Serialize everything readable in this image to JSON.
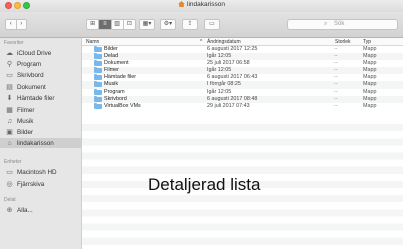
{
  "window": {
    "title": "lindakarisson"
  },
  "toolbar": {
    "back": "‹",
    "forward": "›",
    "view_icons": [
      "⊞",
      "≡",
      "▥",
      "⊡"
    ],
    "arrange": "▦▾",
    "action": "⚙▾",
    "share": "⇪",
    "tag": "▭",
    "search_placeholder": "Sök",
    "search_icon": "⌕"
  },
  "sidebar": {
    "favorites_heading": "Favoriter",
    "favorites": [
      {
        "label": "iCloud Drive",
        "icon": "☁"
      },
      {
        "label": "Program",
        "icon": "⚲"
      },
      {
        "label": "Skrivbord",
        "icon": "▭"
      },
      {
        "label": "Dokument",
        "icon": "▤"
      },
      {
        "label": "Hämtade filer",
        "icon": "⬇"
      },
      {
        "label": "Filmer",
        "icon": "▦"
      },
      {
        "label": "Musik",
        "icon": "♫"
      },
      {
        "label": "Bilder",
        "icon": "▣"
      },
      {
        "label": "lindakarisson",
        "icon": "⌂"
      }
    ],
    "devices_heading": "Enheter",
    "devices": [
      {
        "label": "Macintosh HD",
        "icon": "▭"
      },
      {
        "label": "Fjärrskiva",
        "icon": "◎"
      }
    ],
    "shared_heading": "Delat",
    "shared": [
      {
        "label": "Alla...",
        "icon": "⊕"
      }
    ]
  },
  "columns": {
    "name": "Namn",
    "date": "Ändringsdatum",
    "size": "Storlek",
    "type": "Typ",
    "sort_indicator": "^"
  },
  "files": [
    {
      "name": "Bilder",
      "date": "6 augusti 2017 12:25",
      "size": "--",
      "type": "Mapp"
    },
    {
      "name": "Delad",
      "date": "Igår 12:05",
      "size": "--",
      "type": "Mapp"
    },
    {
      "name": "Dokument",
      "date": "25 juli 2017 06:58",
      "size": "--",
      "type": "Mapp"
    },
    {
      "name": "Filmer",
      "date": "Igår 12:05",
      "size": "--",
      "type": "Mapp"
    },
    {
      "name": "Hämtade filer",
      "date": "6 augusti 2017 06:43",
      "size": "--",
      "type": "Mapp"
    },
    {
      "name": "Musik",
      "date": "I förrgår 08:25",
      "size": "--",
      "type": "Mapp"
    },
    {
      "name": "Program",
      "date": "Igår 12:05",
      "size": "--",
      "type": "Mapp"
    },
    {
      "name": "Skrivbord",
      "date": "6 augusti 2017 08:48",
      "size": "--",
      "type": "Mapp"
    },
    {
      "name": "VirtualBox VMs",
      "date": "29 juli 2017 07:43",
      "size": "--",
      "type": "Mapp"
    }
  ],
  "overlay_caption": "Detaljerad lista"
}
